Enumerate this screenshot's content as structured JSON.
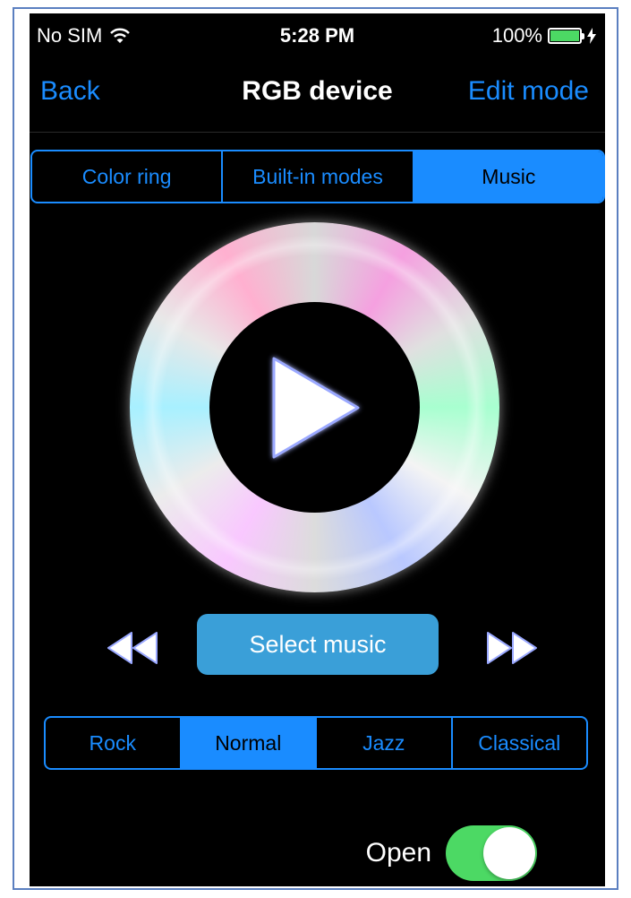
{
  "status_bar": {
    "carrier": "No SIM",
    "time": "5:28 PM",
    "battery": "100%",
    "wifi_icon": "wifi-icon",
    "charging_icon": "bolt-icon"
  },
  "nav": {
    "back": "Back",
    "title": "RGB device",
    "edit": "Edit mode"
  },
  "mode_tabs": {
    "items": [
      "Color ring",
      "Built-in modes",
      "Music"
    ],
    "selected": "Music"
  },
  "player": {
    "play_icon": "play-icon",
    "prev_icon": "rewind-icon",
    "next_icon": "fast-forward-icon",
    "select_music": "Select music"
  },
  "genre_tabs": {
    "items": [
      "Rock",
      "Normal",
      "Jazz",
      "Classical"
    ],
    "selected": "Normal"
  },
  "open_toggle": {
    "label": "Open",
    "on": true
  },
  "colors": {
    "accent": "#1a8cff",
    "toggle_on": "#4cd964",
    "select_button": "#3a9fd8",
    "background": "#000000"
  }
}
